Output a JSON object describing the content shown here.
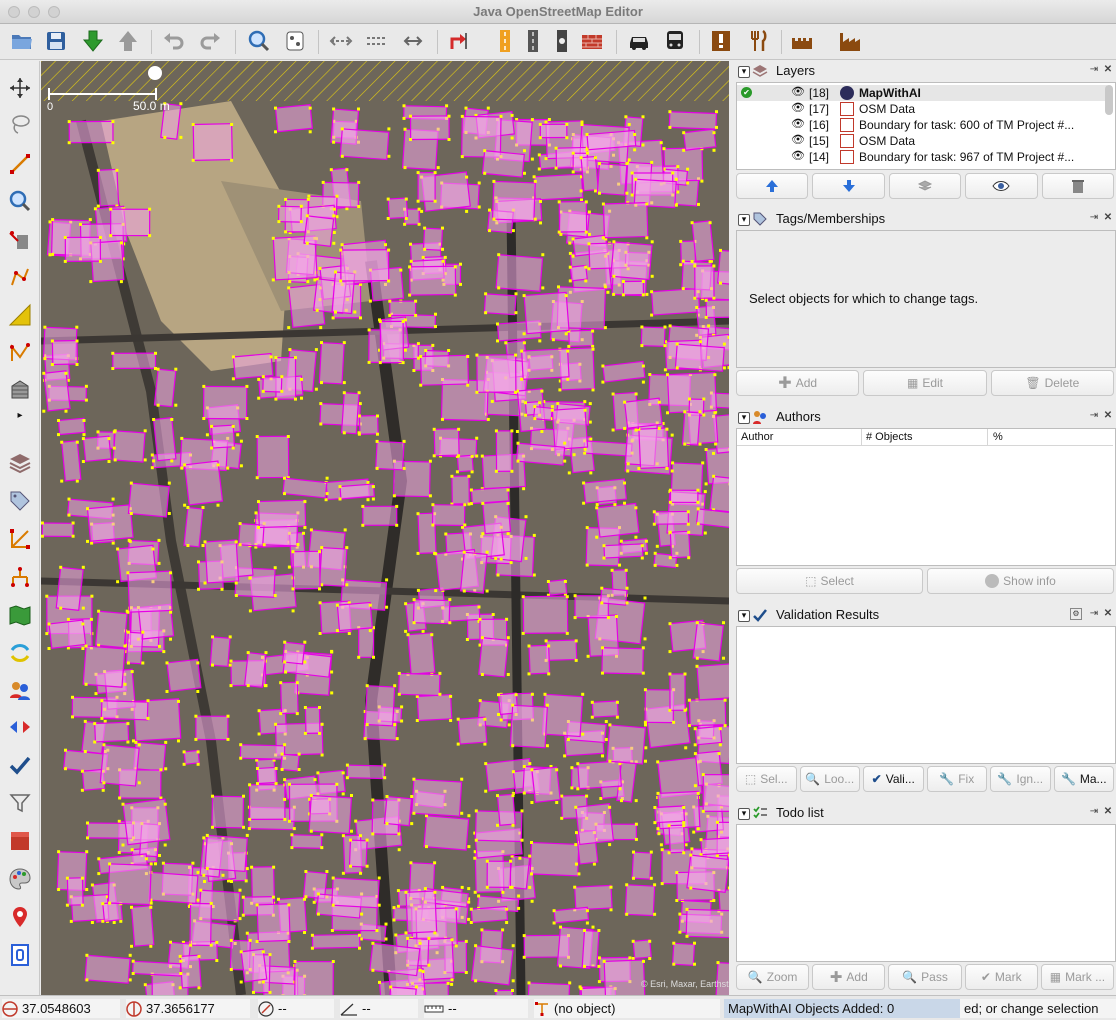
{
  "window": {
    "title": "Java OpenStreetMap Editor"
  },
  "map": {
    "scale_label": "50.0 m",
    "attribution": "© Esri, Maxar, Earthstar",
    "colors": {
      "building_fill": "#f3a6e6",
      "building_stroke": "#e600e6",
      "node": "#ffff00",
      "bbox_hatch": "#ffe400"
    }
  },
  "layers": {
    "title": "Layers",
    "items": [
      {
        "index": "[18]",
        "name": "MapWithAI",
        "active": true
      },
      {
        "index": "[17]",
        "name": "OSM Data",
        "active": false
      },
      {
        "index": "[16]",
        "name": "Boundary for task: 600 of TM Project #...",
        "active": false
      },
      {
        "index": "[15]",
        "name": "OSM Data",
        "active": false
      },
      {
        "index": "[14]",
        "name": "Boundary for task: 967 of TM Project #...",
        "active": false
      }
    ]
  },
  "tags": {
    "title": "Tags/Memberships",
    "empty_text": "Select objects for which to change tags.",
    "buttons": {
      "add": "Add",
      "edit": "Edit",
      "delete": "Delete"
    }
  },
  "authors": {
    "title": "Authors",
    "columns": [
      "Author",
      "# Objects",
      "%"
    ],
    "buttons": {
      "select": "Select",
      "show_info": "Show info"
    }
  },
  "validation": {
    "title": "Validation Results",
    "buttons": [
      "Sel...",
      "Loo...",
      "Vali...",
      "Fix",
      "Ign...",
      "Ma..."
    ]
  },
  "todo": {
    "title": "Todo list",
    "buttons": [
      "Zoom",
      "Add",
      "Pass",
      "Mark",
      "Mark ..."
    ]
  },
  "status": {
    "lat": "37.0548603",
    "lon": "37.3656177",
    "heading": "--",
    "angle": "--",
    "distance": "--",
    "object": "(no object)",
    "mapwithai": "MapWithAI Objects Added: 0",
    "hint": "ed; or change selection"
  }
}
